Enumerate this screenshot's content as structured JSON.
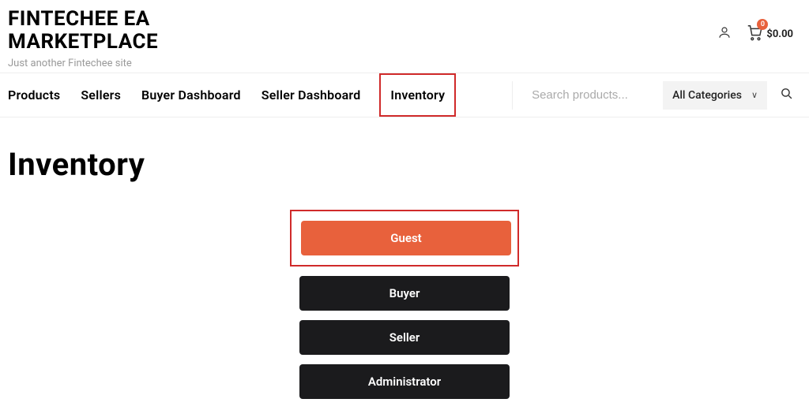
{
  "brand": {
    "title_line1": "FINTECHEE EA",
    "title_line2": "MARKETPLACE",
    "tagline": "Just another Fintechee site"
  },
  "header": {
    "cart_count": "0",
    "cart_amount": "$0.00"
  },
  "nav": {
    "items": [
      {
        "label": "Products"
      },
      {
        "label": "Sellers"
      },
      {
        "label": "Buyer Dashboard"
      },
      {
        "label": "Seller Dashboard"
      },
      {
        "label": "Inventory",
        "highlighted": true
      }
    ]
  },
  "search": {
    "placeholder": "Search products...",
    "category_label": "All Categories"
  },
  "page": {
    "title": "Inventory"
  },
  "roles": {
    "active": "Guest",
    "others": [
      "Buyer",
      "Seller",
      "Administrator"
    ]
  }
}
